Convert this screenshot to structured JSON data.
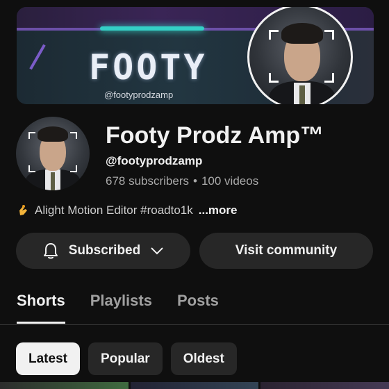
{
  "banner": {
    "title": "FOOTY",
    "handle": "@footyprodzamp"
  },
  "channel": {
    "name": "Footy Prodz Amp™",
    "handle": "@footyprodzamp",
    "subscribers": "678 subscribers",
    "separator": "•",
    "videos": "100 videos"
  },
  "description": {
    "icon": "pinching-hand-icon",
    "text": "Alight Motion Editor #roadto1k",
    "more_label": "...more"
  },
  "actions": {
    "subscribe_label": "Subscribed",
    "visit_label": "Visit community"
  },
  "tabs": [
    {
      "label": "Shorts",
      "active": true
    },
    {
      "label": "Playlists",
      "active": false
    },
    {
      "label": "Posts",
      "active": false
    }
  ],
  "filters": [
    {
      "label": "Latest",
      "active": true
    },
    {
      "label": "Popular",
      "active": false
    },
    {
      "label": "Oldest",
      "active": false
    }
  ],
  "colors": {
    "background": "#0f0f0f",
    "button_bg": "#272727",
    "banner_accent": "#34d0c6",
    "banner_purple": "#6c4fa8"
  }
}
